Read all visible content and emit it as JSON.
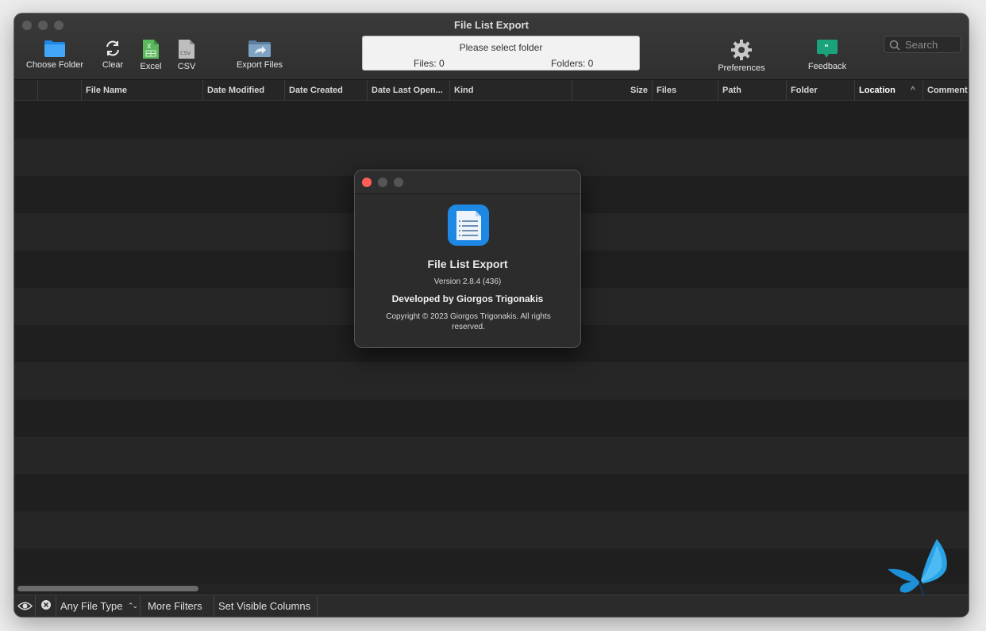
{
  "window": {
    "title": "File List Export"
  },
  "toolbar": {
    "choose_folder": "Choose Folder",
    "clear": "Clear",
    "excel": "Excel",
    "csv": "CSV",
    "export_files": "Export Files",
    "preferences": "Preferences",
    "feedback": "Feedback",
    "excel_icon_text": "X",
    "csv_icon_text": "CSV",
    "feedback_icon_text": "\""
  },
  "status": {
    "message": "Please select folder",
    "files": "Files: 0",
    "folders": "Folders: 0"
  },
  "search": {
    "placeholder": "Search"
  },
  "columns": [
    "File Name",
    "Date Modified",
    "Date Created",
    "Date Last Open...",
    "Kind",
    "Size",
    "Files",
    "Path",
    "Folder",
    "Location",
    "Comment"
  ],
  "sort_indicator": "^",
  "bottom": {
    "file_type": "Any File Type",
    "file_type_chevron": "⌃⌄",
    "more_filters": "More Filters",
    "set_visible_columns": "Set Visible Columns"
  },
  "about": {
    "app_name": "File List Export",
    "version": "Version 2.8.4 (436)",
    "developer": "Developed by Giorgos Trigonakis",
    "copyright": "Copyright © 2023 Giorgos Trigonakis. All rights reserved."
  },
  "colors": {
    "accent": "#1e88e5",
    "close": "#ff5f57",
    "excel": "#4caf50",
    "feedback": "#1aa37a"
  }
}
